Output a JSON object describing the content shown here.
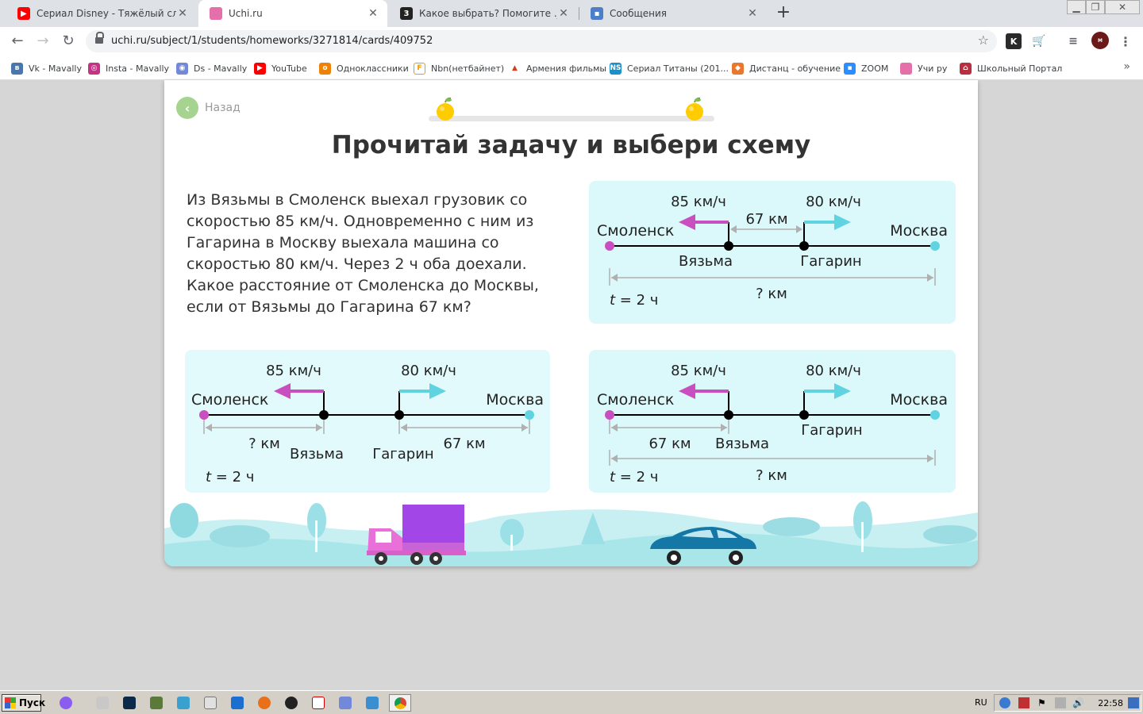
{
  "browser": {
    "tabs": [
      {
        "title": "Сериал Disney - Тяжёлый случай (",
        "icon": "youtube-icon",
        "color": "#ff0000",
        "active": false
      },
      {
        "title": "Uchi.ru",
        "icon": "uchi-icon",
        "color": "#e56fa8",
        "active": true
      },
      {
        "title": "Какое выбрать? Помогите ._. - Ш",
        "icon": "znanija-icon",
        "color": "#222222",
        "active": false
      },
      {
        "title": "Сообщения",
        "icon": "chat-icon",
        "color": "#4d7fc8",
        "active": false
      }
    ],
    "close_glyph": "✕",
    "new_tab_glyph": "+",
    "url": "uchi.ru/subject/1/students/homeworks/3271814/cards/409752",
    "bookmarks": [
      {
        "label": "Vk - Mavally",
        "icon": "vk-icon",
        "color": "#4a76a8"
      },
      {
        "label": "Insta - Mavally",
        "icon": "instagram-icon",
        "color": "#c13584"
      },
      {
        "label": "Ds - Mavally",
        "icon": "discord-icon",
        "color": "#7289da"
      },
      {
        "label": "YouTube",
        "icon": "youtube-icon",
        "color": "#ff0000"
      },
      {
        "label": "Одноклассники",
        "icon": "ok-icon",
        "color": "#ee8208"
      },
      {
        "label": "Nbn(нетбайнет)",
        "icon": "netbynet-icon",
        "color": "#f09a00"
      },
      {
        "label": "Армения фильмы",
        "icon": "armenia-icon",
        "color": "#d04020"
      },
      {
        "label": "Сериал Титаны (201...",
        "icon": "ns-icon",
        "color": "#1e90c8"
      },
      {
        "label": "Дистанц - обучение",
        "icon": "fox-icon",
        "color": "#e87830"
      },
      {
        "label": "ZOOM",
        "icon": "zoom-icon",
        "color": "#2d8cff"
      },
      {
        "label": "Учи ру",
        "icon": "uchi-icon",
        "color": "#e56fa8"
      },
      {
        "label": "Школьный Портал",
        "icon": "school-portal-icon",
        "color": "#b83040"
      }
    ],
    "bookmarks_more": "»"
  },
  "page": {
    "back_label": "Назад",
    "title": "Прочитай задачу и выбери схему",
    "problem_text": "Из Вязьмы в Смоленск выехал грузовик со скоростью 85 км/ч. Одновременно с ним из Гагарина в Москву выехала машина со скоростью 80 км/ч. Через 2 ч оба доехали. Какое расстояние от Смоленска до Москвы, если от Вязьмы до Гагарина 67 км?",
    "colors": {
      "magenta": "#c94fc0",
      "cyan": "#5fd4e0",
      "card_bg": "#e2fafb",
      "gray_arrow": "#b0b0b0"
    },
    "schemes": [
      {
        "speed_left": "85 км/ч",
        "speed_right": "80 км/ч",
        "city_left": "Смоленск",
        "city_right": "Москва",
        "point_a": "Вязьма",
        "point_b": "Гагарин",
        "middle_distance": "67 км",
        "total_distance": "? км",
        "time_var": "t",
        "time_value": " = 2 ч"
      },
      {
        "speed_left": "85 км/ч",
        "speed_right": "80 км/ч",
        "city_left": "Смоленск",
        "city_right": "Москва",
        "point_a": "Вязьма",
        "point_b": "Гагарин",
        "left_distance": "? км",
        "right_distance": "67 км",
        "time_var": "t",
        "time_value": " = 2 ч"
      },
      {
        "speed_left": "85 км/ч",
        "speed_right": "80 км/ч",
        "city_left": "Смоленск",
        "city_right": "Москва",
        "point_a": "Вязьма",
        "point_b": "Гагарин",
        "left_distance": "67 км",
        "total_distance": "? км",
        "time_var": "t",
        "time_value": " = 2 ч"
      }
    ]
  },
  "taskbar": {
    "start_label": "Пуск",
    "lang": "RU",
    "time": "22:58"
  }
}
